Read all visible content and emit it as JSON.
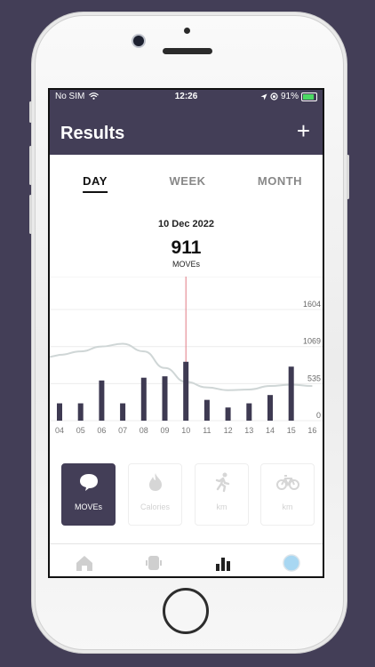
{
  "status_bar": {
    "carrier": "No SIM",
    "time": "12:26",
    "battery": "91%"
  },
  "header": {
    "title": "Results",
    "add_label": "+"
  },
  "tabs": [
    {
      "label": "DAY",
      "active": true
    },
    {
      "label": "WEEK",
      "active": false
    },
    {
      "label": "MONTH",
      "active": false
    }
  ],
  "summary": {
    "date": "10 Dec 2022",
    "value": "911",
    "unit": "MOVEs"
  },
  "chart_data": {
    "type": "bar",
    "categories": [
      "04",
      "05",
      "06",
      "07",
      "08",
      "09",
      "10",
      "11",
      "12",
      "13",
      "14",
      "15",
      "16"
    ],
    "values": [
      250,
      250,
      580,
      250,
      620,
      640,
      850,
      300,
      190,
      250,
      370,
      780,
      0
    ],
    "trend_line": [
      950,
      1000,
      1070,
      1110,
      1000,
      760,
      560,
      480,
      440,
      450,
      500,
      520,
      500
    ],
    "selected_index": 6,
    "yticks": [
      0,
      535,
      1069,
      1604
    ],
    "ylim": [
      0,
      1900
    ],
    "colors": {
      "bar": "#3e3a52",
      "trend": "#cfd6d6",
      "selected_line": "#e07a84",
      "grid": "#ececec"
    }
  },
  "activity_cards": [
    {
      "label": "MOVEs",
      "icon": "bubble-icon",
      "active": true
    },
    {
      "label": "Calories",
      "icon": "flame-icon",
      "active": false
    },
    {
      "label": "km",
      "icon": "runner-icon",
      "active": false
    },
    {
      "label": "km",
      "icon": "bicycle-icon",
      "active": false
    }
  ],
  "tab_bar": [
    {
      "icon": "home-icon"
    },
    {
      "icon": "device-icon"
    },
    {
      "icon": "bar-chart-icon",
      "active": true
    },
    {
      "icon": "profile-icon"
    }
  ]
}
